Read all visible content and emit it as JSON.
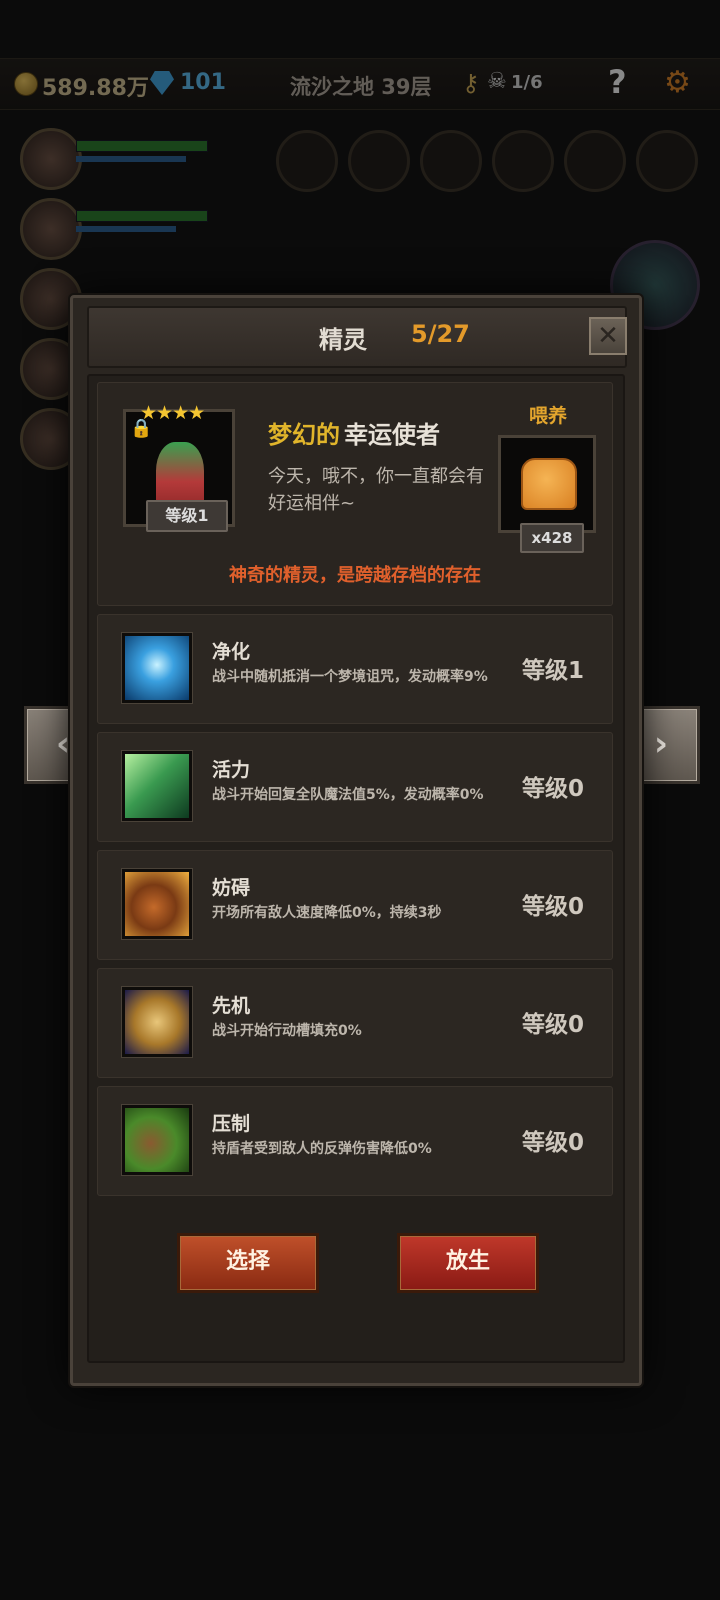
{
  "topbar": {
    "gold": "589.88万",
    "gems": "101",
    "floor": "流沙之地 39层",
    "skulls": "1/6",
    "help": "?"
  },
  "modal": {
    "title": "精灵",
    "count": "5/27",
    "close": "✕"
  },
  "spirit": {
    "name_prefix": "梦幻的",
    "name_main": "幸运使者",
    "description": "今天，哦不，你一直都会有好运相伴~",
    "level": "等级1",
    "stars": "★★★★",
    "feed_label": "喂养",
    "feed_count": "x428",
    "tagline": "神奇的精灵，是跨越存档的存在"
  },
  "skills": [
    {
      "name": "净化",
      "desc": "战斗中随机抵消一个梦境诅咒，发动概率9%",
      "level": "等级1",
      "icon": "flower-icon"
    },
    {
      "name": "活力",
      "desc": "战斗开始回复全队魔法值5%，发动概率0%",
      "level": "等级0",
      "icon": "prayer-icon"
    },
    {
      "name": "妨碍",
      "desc": "开场所有敌人速度降低0%，持续3秒",
      "level": "等级0",
      "icon": "chain-boot-icon"
    },
    {
      "name": "先机",
      "desc": "战斗开始行动槽填充0%",
      "level": "等级0",
      "icon": "leopard-icon"
    },
    {
      "name": "压制",
      "desc": "持盾者受到敌人的反弹伤害降低0%",
      "level": "等级0",
      "icon": "claw-icon"
    }
  ],
  "buttons": {
    "select": "选择",
    "release": "放生"
  },
  "arrows": {
    "prev": "‹",
    "next": "›"
  }
}
